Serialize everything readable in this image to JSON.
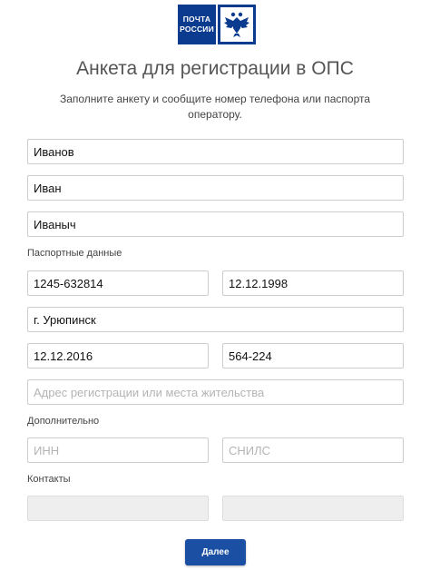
{
  "logo": {
    "line1": "ПОЧТА",
    "line2": "РОССИИ"
  },
  "header": {
    "title": "Анкета для регистрации в ОПС",
    "subtitle": "Заполните анкету и сообщите номер телефона или паспорта оператору."
  },
  "form": {
    "last_name": "Иванов",
    "first_name": "Иван",
    "patronymic": "Иваныч",
    "passport_label": "Паспортные данные",
    "passport_number": "1245-632814",
    "birth_date": "12.12.1998",
    "birth_place": "г. Урюпинск",
    "issue_date": "12.12.2016",
    "division_code": "564-224",
    "address_placeholder": "Адрес регистрации или места жительства",
    "additional_label": "Дополнительно",
    "inn_placeholder": "ИНН",
    "snils_placeholder": "СНИЛС",
    "contacts_label": "Контакты",
    "phone_value": "",
    "email_value": "",
    "submit_label": "Далее"
  },
  "colors": {
    "brand": "#0b3b8f",
    "button": "#1a4fa3",
    "border": "#cccccc"
  }
}
